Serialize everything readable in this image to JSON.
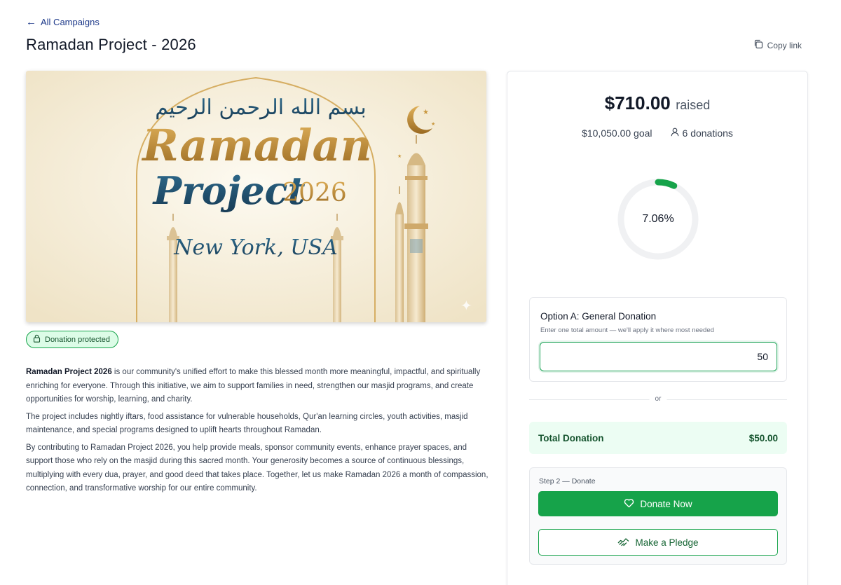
{
  "nav": {
    "back_label": "All Campaigns",
    "back_icon": "arrow-left-icon"
  },
  "page": {
    "title": "Ramadan Project - 2026",
    "copy_link_label": "Copy link"
  },
  "banner": {
    "arabic_text": "بسم الله الرحمن الرحيم",
    "line1": "Ramadan",
    "line2": "Project",
    "year": "2026",
    "location": "New York, USA"
  },
  "badge": {
    "label": "Donation protected"
  },
  "description": {
    "p1_bold": "Ramadan Project 2026",
    "p1_rest": " is our community's unified effort to make this blessed month more meaningful, impactful, and spiritually enriching for everyone. Through this initiative, we aim to support families in need, strengthen our masjid programs, and create opportunities for worship, learning, and charity.",
    "p2": "The project includes nightly iftars, food assistance for vulnerable households, Qur'an learning circles, youth activities, masjid maintenance, and special programs designed to uplift hearts throughout Ramadan.",
    "p3": "By contributing to Ramadan Project 2026, you help provide meals, sponsor community events, enhance prayer spaces, and support those who rely on the masjid during this sacred month. Your generosity becomes a source of continuous blessings, multiplying with every dua, prayer, and good deed that takes place. Together, let us make Ramadan 2026 a month of compassion, connection, and transformative worship for our entire community."
  },
  "stats": {
    "raised_amount": "$710.00",
    "raised_suffix": "raised",
    "goal_text": "$10,050.00 goal",
    "donations_text": "6 donations",
    "progress_label": "7.06%",
    "progress_fraction": 0.0706
  },
  "option_a": {
    "title": "Option A: General Donation",
    "subtitle": "Enter one total amount — we'll apply it where most needed",
    "amount_value": "50"
  },
  "divider": {
    "label": "or"
  },
  "total": {
    "label": "Total Donation",
    "amount": "$50.00"
  },
  "step2": {
    "label": "Step 2 — Donate",
    "donate_label": "Donate Now",
    "pledge_label": "Make a Pledge"
  },
  "colors": {
    "accent_green": "#16a34a",
    "link_blue": "#1e3a8a",
    "gold": "#b8893a",
    "teal": "#1f4e6b"
  }
}
